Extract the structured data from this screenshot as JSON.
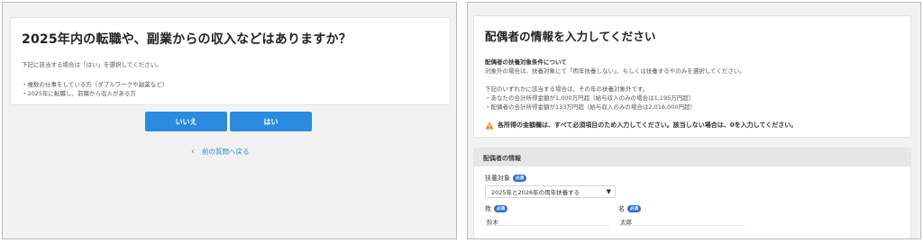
{
  "left": {
    "question": "2025年内の転職や、副業からの収入などはありますか？",
    "intro": "下記に該当する場合は「はい」を選択してください。",
    "items": [
      "・複数の仕事をしている方（ダブルワークや副業など）",
      "・2025年に転職し、前職から収入がある方"
    ],
    "no_label": "いいえ",
    "yes_label": "はい",
    "back_chevron": "‹",
    "back_label": "前の質問へ戻る"
  },
  "right": {
    "title": "配偶者の情報を入力してください",
    "cond_title": "配偶者の扶養対象条件について",
    "cond_text": "対象外の場合は、扶養対象にて「両年扶養しない」、もしくは扶養するやのみを選択してください。",
    "cond_text2": "下記のいずれかに該当する場合は、その年の扶養対象外です。",
    "cond_items": [
      "・あなたの合計所得金額が1,000万円超（給与収入のみの場合は1,195万円超）",
      "・配偶者の合計所得金額が133万円超（給与収入のみの場合は2,016,000円超）"
    ],
    "warning": "各所得の金額欄は、すべて必須項目のため入力してください。該当しない場合は、0を入力してください。",
    "warning_icon": "warning-triangle-icon",
    "section_title": "配偶者の情報",
    "support_label": "扶養対象",
    "support_badge": "必須",
    "support_value": "2025年と2026年の両年扶養する",
    "last_label": "姓",
    "last_badge": "必須",
    "last_value": "鈴木",
    "first_label": "名",
    "first_badge": "必須",
    "first_value": "太郎"
  },
  "colors": {
    "accent": "#2b8be0",
    "badge": "#2b6fd6",
    "warning": "#e8890c"
  }
}
